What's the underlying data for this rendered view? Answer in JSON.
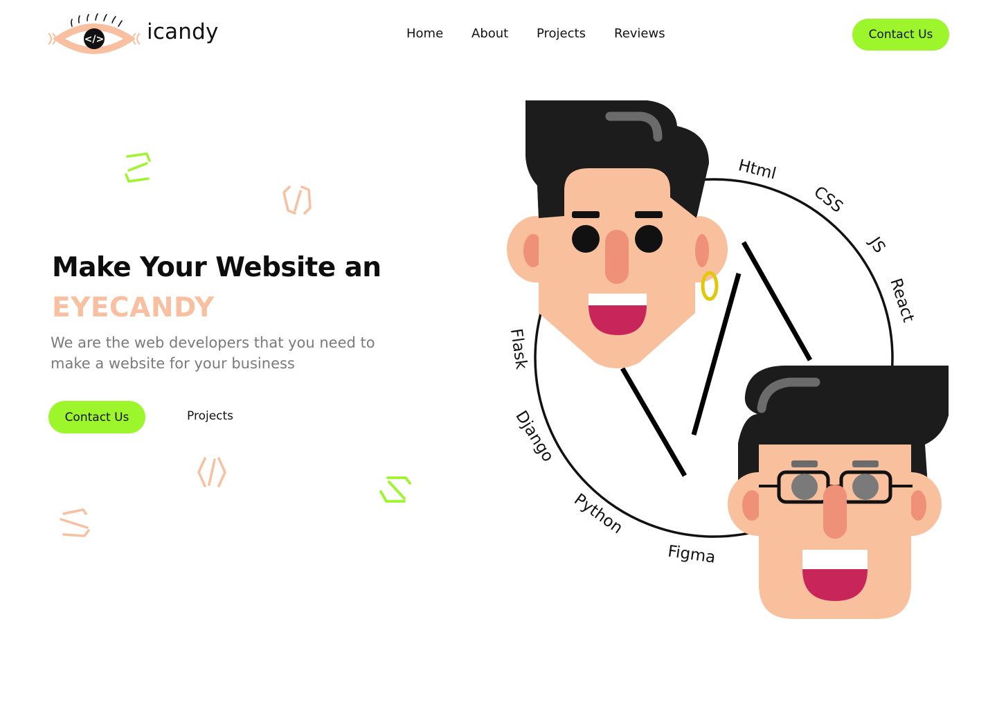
{
  "brand": {
    "name": "icandy"
  },
  "nav": {
    "items": [
      {
        "label": "Home"
      },
      {
        "label": "About"
      },
      {
        "label": "Projects"
      },
      {
        "label": "Reviews"
      }
    ],
    "cta_label": "Contact Us"
  },
  "hero": {
    "title": "Make Your Website an",
    "highlight": "EYECANDY",
    "subtitle": "We are the web developers that you need to make a website for your business",
    "primary_cta": "Contact Us",
    "secondary_link": "Projects"
  },
  "illustration": {
    "technologies": [
      "Html",
      "CSS",
      "JS",
      "React",
      "Flask",
      "Django",
      "Python",
      "Figma"
    ]
  },
  "colors": {
    "accent": "#9df52c",
    "peach": "#f8c0a0",
    "skin": "#f9c09e",
    "hair": "#1c1c1c",
    "mouth": "#c8265a",
    "earring": "#e0c80a"
  }
}
